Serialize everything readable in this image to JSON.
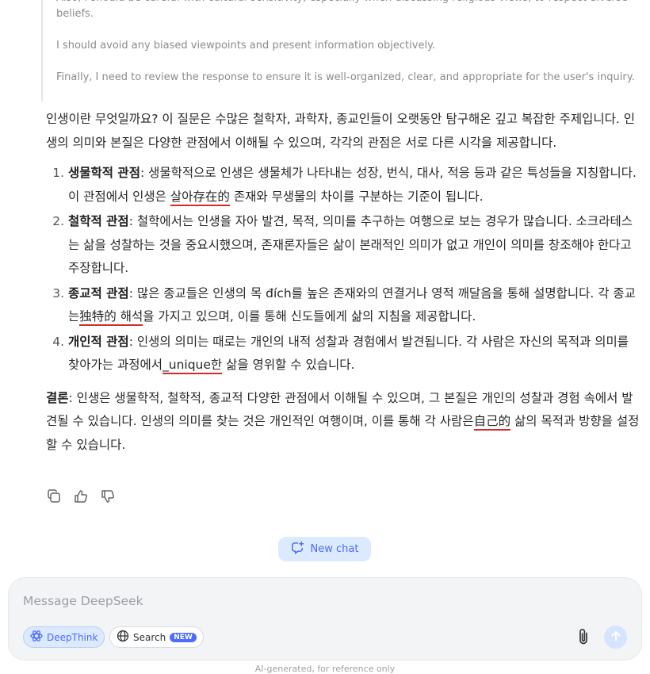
{
  "thinking": {
    "lines": [
      "Also, I should be careful with cultural sensitivity, especially when discussing religious views, to respect diverse beliefs.",
      "I should avoid any biased viewpoints and present information objectively.",
      "Finally, I need to review the response to ensure it is well-organized, clear, and appropriate for the user's inquiry."
    ]
  },
  "answer": {
    "intro": "인생이란 무엇일까요? 이 질문은 수많은 철학자, 과학자, 종교인들이 오랫동안 탐구해온 깊고 복잡한 주제입니다. 인생의 의미와 본질은 다양한 관점에서 이해될 수 있으며, 각각의 관점은 서로 다른 시각을 제공합니다.",
    "items": [
      {
        "title": "생물학적 관점",
        "pre": ": 생물학적으로 인생은 생물체가 나타내는 성장, 번식, 대사, 적응 등과 같은 특성들을 지칭합니다. 이 관점에서 인생은 ",
        "mark": "살아存在的",
        "post": " 존재와 무생물의 차이를 구분하는 기준이 됩니다."
      },
      {
        "title": "철학적 관점",
        "pre": ": 철학에서는 인생을 자아 발견, 목적, 의미를 추구하는 여행으로 보는 경우가 많습니다. 소크라테스는 삶을 성찰하는 것을 중요시했으며, 존재론자들은 삶이 본래적인 의미가 없고 개인이 의미를 창조해야 한다고 주장합니다.",
        "mark": "",
        "post": ""
      },
      {
        "title": "종교적 관점",
        "pre": ": 많은 종교들은 인생의 목 đích를 높은 존재와의 연결거나 영적 깨달음을 통해 설명합니다. 각 종교는",
        "mark": "独特的 해석",
        "post": "을 가지고 있으며, 이를 통해 신도들에게 삶의 지침을 제공합니다."
      },
      {
        "title": "개인적 관점",
        "pre": ": 인생의 의미는 때로는 개인의 내적 성찰과 경험에서 발견됩니다. 각 사람은 자신의 목적과 의미를 찾아가는 과정에서",
        "mark": "_unique한",
        "post": " 삶을 영위할 수 있습니다."
      }
    ],
    "conclusion_label": "결론",
    "conclusion_pre": ": 인생은 생물학적, 철학적, 종교적 다양한 관점에서 이해될 수 있으며, 그 본질은 개인의 성찰과 경험 속에서 발견될 수 있습니다. 인생의 의미를 찾는 것은 개인적인 여행이며, 이를 통해 각 사람은",
    "conclusion_mark": "自己的",
    "conclusion_post": " 삶의 목적과 방향을 설정할 수 있습니다."
  },
  "actions": {
    "icons": [
      "copy-icon",
      "thumbs-up-icon",
      "thumbs-down-icon"
    ]
  },
  "new_chat": {
    "label": "New chat"
  },
  "composer": {
    "placeholder": "Message DeepSeek",
    "deepthink_label": "DeepThink",
    "search_label": "Search",
    "search_badge": "NEW"
  },
  "footer": {
    "text": "AI-generated, for reference only"
  },
  "colors": {
    "accent": "#4d6bfe",
    "accent_bg": "#dbeafe",
    "underline": "#d42a2a"
  }
}
